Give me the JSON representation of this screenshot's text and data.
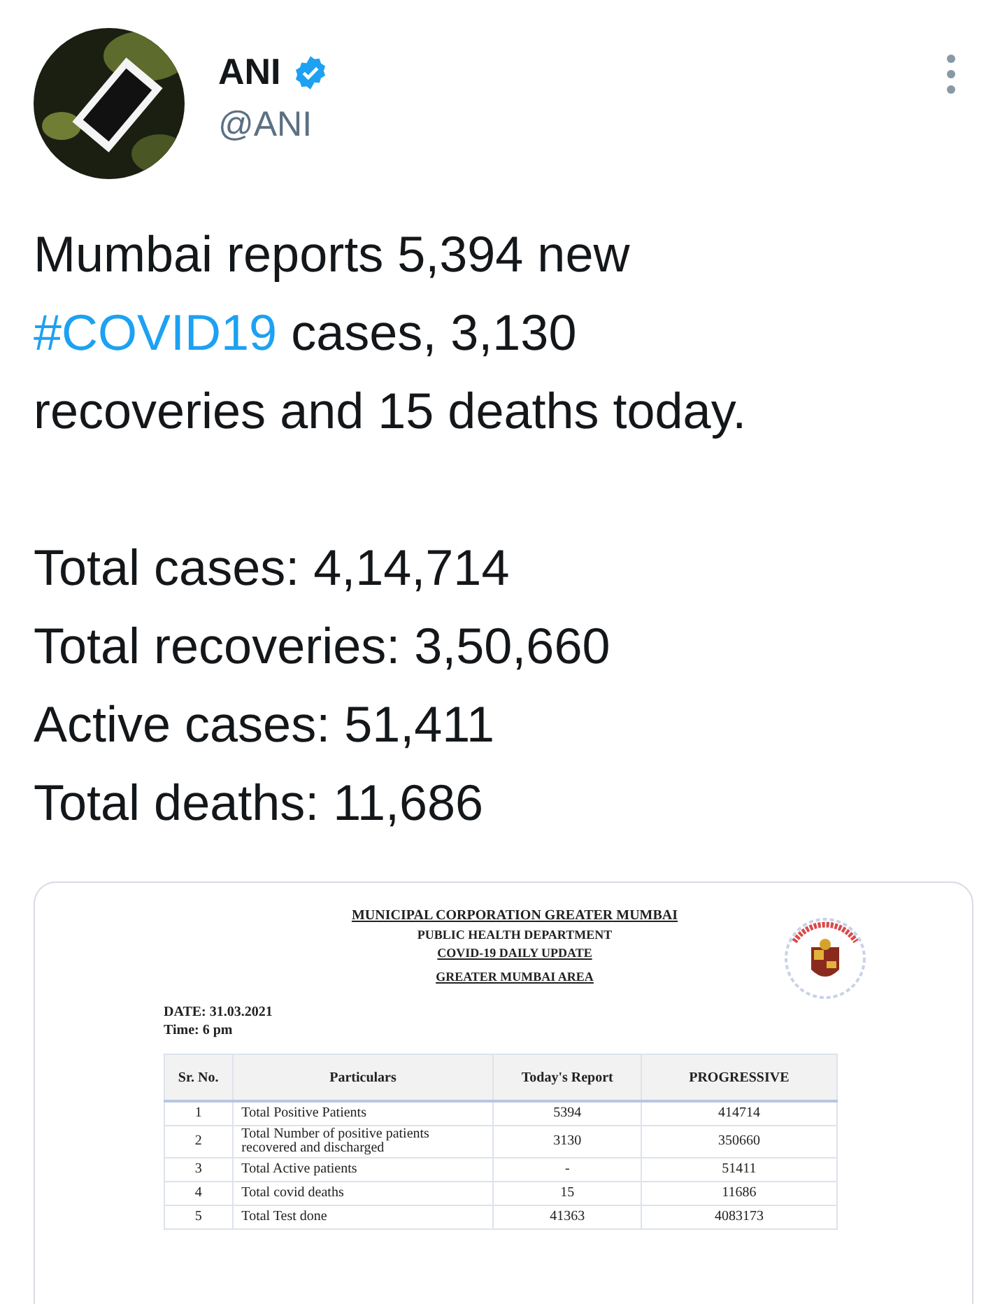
{
  "author": {
    "name": "ANI",
    "verified": true,
    "handle": "@ANI"
  },
  "tweet_lines": [
    [
      {
        "kind": "text",
        "text": "Mumbai reports 5,394 new"
      }
    ],
    [
      {
        "kind": "hashtag",
        "text": "#COVID19"
      },
      {
        "kind": "text",
        "text": " cases, 3,130"
      }
    ],
    [
      {
        "kind": "text",
        "text": "recoveries and 15 deaths today."
      }
    ]
  ],
  "totals": [
    "Total cases: 4,14,714",
    "Total recoveries: 3,50,660",
    "Active cases: 51,411",
    "Total deaths: 11,686"
  ],
  "document": {
    "headings": [
      {
        "text": "MUNICIPAL CORPORATION GREATER MUMBAI",
        "underlined": true
      },
      {
        "text": "PUBLIC HEALTH DEPARTMENT",
        "underlined": false
      },
      {
        "text": "COVID-19 DAILY UPDATE",
        "underlined": true
      },
      {
        "text": "GREATER MUMBAI AREA",
        "underlined": true
      }
    ],
    "date": "DATE: 31.03.2021",
    "time": "Time: 6 pm",
    "table": {
      "columns": [
        "Sr. No.",
        "Particulars",
        "Today's Report",
        "PROGRESSIVE"
      ],
      "rows": [
        [
          "1",
          "Total Positive Patients",
          "5394",
          "414714"
        ],
        [
          "2",
          "Total Number of  positive patients recovered and discharged",
          "3130",
          "350660"
        ],
        [
          "3",
          "Total Active patients",
          "-",
          "51411"
        ],
        [
          "4",
          "Total covid deaths",
          "15",
          "11686"
        ],
        [
          "5",
          "Total Test done",
          "41363",
          "4083173"
        ]
      ]
    }
  }
}
